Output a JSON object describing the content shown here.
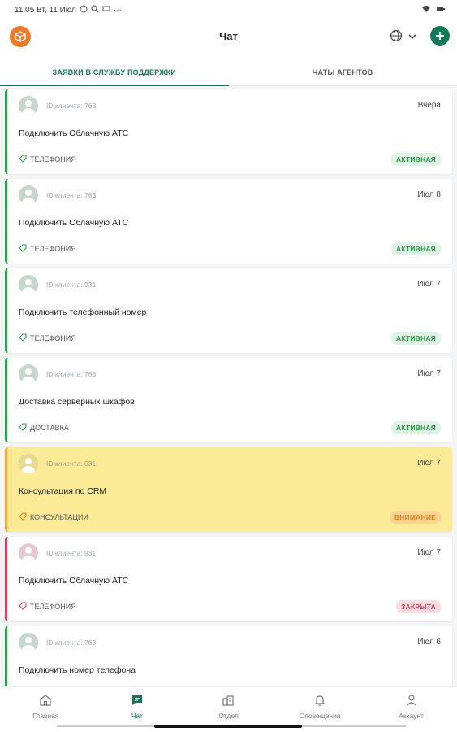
{
  "status_bar": {
    "time": "11:05 Вт, 11 Июл",
    "more": "···"
  },
  "header": {
    "title": "Чат"
  },
  "tabs": [
    {
      "label": "ЗАЯВКИ В СЛУЖБУ ПОДДЕРЖКИ",
      "active": true
    },
    {
      "label": "ЧАТЫ АГЕНТОВ",
      "active": false
    }
  ],
  "tickets": [
    {
      "client": "ID клиента: 763",
      "date": "Вчера",
      "subject": "Подключить Облачную АТС",
      "tag": "ТЕЛЕФОНИЯ",
      "status": "АКТИВНАЯ",
      "kind": "active"
    },
    {
      "client": "ID клиента: 763",
      "date": "Июл 8",
      "subject": "Подключить Облачную АТС",
      "tag": "ТЕЛЕФОНИЯ",
      "status": "АКТИВНАЯ",
      "kind": "active"
    },
    {
      "client": "ID клиента: 931",
      "date": "Июл 7",
      "subject": "Подключить телефонный номер",
      "tag": "ТЕЛЕФОНИЯ",
      "status": "АКТИВНАЯ",
      "kind": "active"
    },
    {
      "client": "ID клиента: 763",
      "date": "Июл 7",
      "subject": "Доставка серверных шкафов",
      "tag": "ДОСТАВКА",
      "status": "АКТИВНАЯ",
      "kind": "active"
    },
    {
      "client": "ID клиента: 931",
      "date": "Июл 7",
      "subject": "Консультация по CRM",
      "tag": "КОНСУЛЬТАЦИИ",
      "status": "ВНИМАНИЕ",
      "kind": "warn"
    },
    {
      "client": "ID клиента: 931",
      "date": "Июл 7",
      "subject": "Подключить Облачную АТС",
      "tag": "ТЕЛЕФОНИЯ",
      "status": "ЗАКРЫТА",
      "kind": "closed"
    },
    {
      "client": "ID клиента: 763",
      "date": "Июл 6",
      "subject": "Подключить номер телефона",
      "tag": "",
      "status": "",
      "kind": "active"
    }
  ],
  "bottom_nav": [
    {
      "label": "Главная",
      "icon": "home-icon",
      "active": false
    },
    {
      "label": "Чат",
      "icon": "chat-icon",
      "active": true
    },
    {
      "label": "Отдел",
      "icon": "building-icon",
      "active": false
    },
    {
      "label": "Оповещения",
      "icon": "bell-icon",
      "active": false
    },
    {
      "label": "Аккаунт",
      "icon": "person-icon",
      "active": false
    }
  ],
  "colors": {
    "accent": "#0f7a55",
    "logo": "#f07a26",
    "active": "#2aa14a",
    "warning": "#f2a93b",
    "closed": "#d0465e"
  }
}
